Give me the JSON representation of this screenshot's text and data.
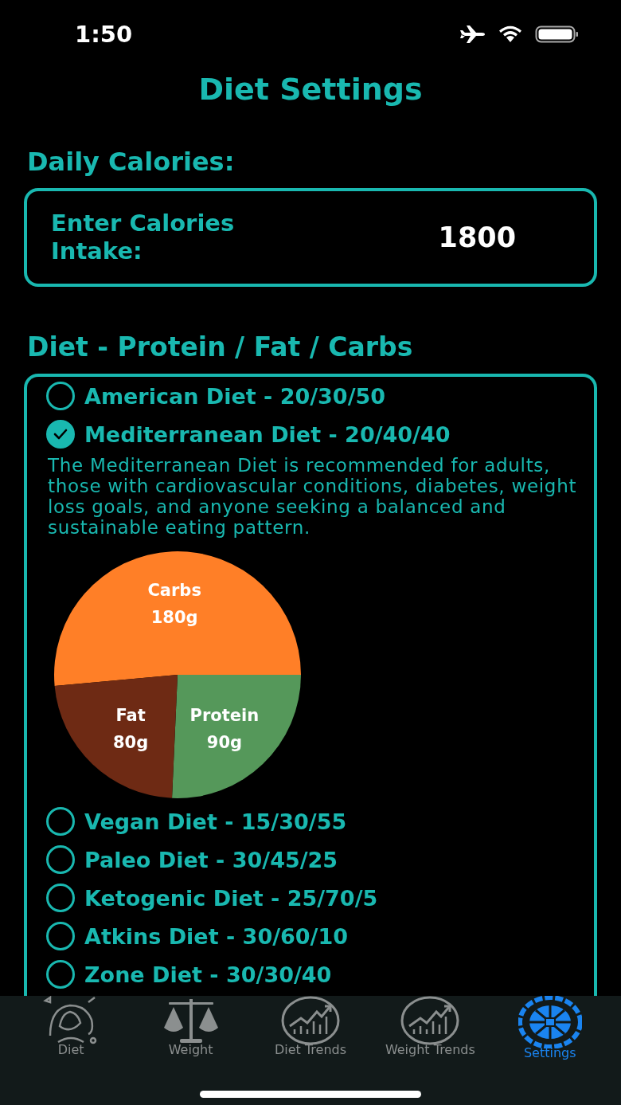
{
  "status_bar": {
    "time": "1:50"
  },
  "title": "Diet Settings",
  "daily_calories": {
    "heading": "Daily Calories:",
    "label": "Enter Calories Intake:",
    "value": "1800"
  },
  "diet": {
    "heading": "Diet - Protein / Fat / Carbs",
    "options": [
      {
        "label": "American Diet - 20/30/50",
        "selected": false
      },
      {
        "label": "Mediterranean Diet - 20/40/40",
        "selected": true,
        "description": "The Mediterranean Diet is recommended for adults, those with cardiovascular conditions, diabetes, weight loss goals, and anyone seeking a balanced and sustainable eating pattern.",
        "chart_data": {
          "type": "pie",
          "categories": [
            "Carbs",
            "Protein",
            "Fat"
          ],
          "values": [
            180,
            90,
            80
          ],
          "value_labels": [
            "180g",
            "90g",
            "80g"
          ]
        }
      },
      {
        "label": "Vegan Diet - 15/30/55",
        "selected": false
      },
      {
        "label": "Paleo Diet - 30/45/25",
        "selected": false
      },
      {
        "label": "Ketogenic Diet - 25/70/5",
        "selected": false
      },
      {
        "label": "Atkins Diet - 30/60/10",
        "selected": false
      },
      {
        "label": "Zone Diet - 30/30/40",
        "selected": false
      }
    ]
  },
  "tabs": [
    {
      "label": "Diet",
      "selected": false
    },
    {
      "label": "Weight",
      "selected": false
    },
    {
      "label": "Diet Trends",
      "selected": false
    },
    {
      "label": "Weight Trends",
      "selected": false
    },
    {
      "label": "Settings",
      "selected": true
    }
  ]
}
